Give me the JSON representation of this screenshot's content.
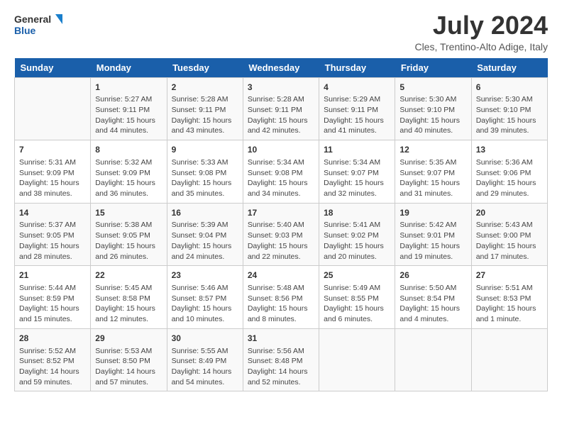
{
  "header": {
    "logo_line1": "General",
    "logo_line2": "Blue",
    "month_year": "July 2024",
    "location": "Cles, Trentino-Alto Adige, Italy"
  },
  "weekdays": [
    "Sunday",
    "Monday",
    "Tuesday",
    "Wednesday",
    "Thursday",
    "Friday",
    "Saturday"
  ],
  "weeks": [
    [
      {
        "day": "",
        "info": ""
      },
      {
        "day": "1",
        "info": "Sunrise: 5:27 AM\nSunset: 9:11 PM\nDaylight: 15 hours\nand 44 minutes."
      },
      {
        "day": "2",
        "info": "Sunrise: 5:28 AM\nSunset: 9:11 PM\nDaylight: 15 hours\nand 43 minutes."
      },
      {
        "day": "3",
        "info": "Sunrise: 5:28 AM\nSunset: 9:11 PM\nDaylight: 15 hours\nand 42 minutes."
      },
      {
        "day": "4",
        "info": "Sunrise: 5:29 AM\nSunset: 9:11 PM\nDaylight: 15 hours\nand 41 minutes."
      },
      {
        "day": "5",
        "info": "Sunrise: 5:30 AM\nSunset: 9:10 PM\nDaylight: 15 hours\nand 40 minutes."
      },
      {
        "day": "6",
        "info": "Sunrise: 5:30 AM\nSunset: 9:10 PM\nDaylight: 15 hours\nand 39 minutes."
      }
    ],
    [
      {
        "day": "7",
        "info": "Sunrise: 5:31 AM\nSunset: 9:09 PM\nDaylight: 15 hours\nand 38 minutes."
      },
      {
        "day": "8",
        "info": "Sunrise: 5:32 AM\nSunset: 9:09 PM\nDaylight: 15 hours\nand 36 minutes."
      },
      {
        "day": "9",
        "info": "Sunrise: 5:33 AM\nSunset: 9:08 PM\nDaylight: 15 hours\nand 35 minutes."
      },
      {
        "day": "10",
        "info": "Sunrise: 5:34 AM\nSunset: 9:08 PM\nDaylight: 15 hours\nand 34 minutes."
      },
      {
        "day": "11",
        "info": "Sunrise: 5:34 AM\nSunset: 9:07 PM\nDaylight: 15 hours\nand 32 minutes."
      },
      {
        "day": "12",
        "info": "Sunrise: 5:35 AM\nSunset: 9:07 PM\nDaylight: 15 hours\nand 31 minutes."
      },
      {
        "day": "13",
        "info": "Sunrise: 5:36 AM\nSunset: 9:06 PM\nDaylight: 15 hours\nand 29 minutes."
      }
    ],
    [
      {
        "day": "14",
        "info": "Sunrise: 5:37 AM\nSunset: 9:05 PM\nDaylight: 15 hours\nand 28 minutes."
      },
      {
        "day": "15",
        "info": "Sunrise: 5:38 AM\nSunset: 9:05 PM\nDaylight: 15 hours\nand 26 minutes."
      },
      {
        "day": "16",
        "info": "Sunrise: 5:39 AM\nSunset: 9:04 PM\nDaylight: 15 hours\nand 24 minutes."
      },
      {
        "day": "17",
        "info": "Sunrise: 5:40 AM\nSunset: 9:03 PM\nDaylight: 15 hours\nand 22 minutes."
      },
      {
        "day": "18",
        "info": "Sunrise: 5:41 AM\nSunset: 9:02 PM\nDaylight: 15 hours\nand 20 minutes."
      },
      {
        "day": "19",
        "info": "Sunrise: 5:42 AM\nSunset: 9:01 PM\nDaylight: 15 hours\nand 19 minutes."
      },
      {
        "day": "20",
        "info": "Sunrise: 5:43 AM\nSunset: 9:00 PM\nDaylight: 15 hours\nand 17 minutes."
      }
    ],
    [
      {
        "day": "21",
        "info": "Sunrise: 5:44 AM\nSunset: 8:59 PM\nDaylight: 15 hours\nand 15 minutes."
      },
      {
        "day": "22",
        "info": "Sunrise: 5:45 AM\nSunset: 8:58 PM\nDaylight: 15 hours\nand 12 minutes."
      },
      {
        "day": "23",
        "info": "Sunrise: 5:46 AM\nSunset: 8:57 PM\nDaylight: 15 hours\nand 10 minutes."
      },
      {
        "day": "24",
        "info": "Sunrise: 5:48 AM\nSunset: 8:56 PM\nDaylight: 15 hours\nand 8 minutes."
      },
      {
        "day": "25",
        "info": "Sunrise: 5:49 AM\nSunset: 8:55 PM\nDaylight: 15 hours\nand 6 minutes."
      },
      {
        "day": "26",
        "info": "Sunrise: 5:50 AM\nSunset: 8:54 PM\nDaylight: 15 hours\nand 4 minutes."
      },
      {
        "day": "27",
        "info": "Sunrise: 5:51 AM\nSunset: 8:53 PM\nDaylight: 15 hours\nand 1 minute."
      }
    ],
    [
      {
        "day": "28",
        "info": "Sunrise: 5:52 AM\nSunset: 8:52 PM\nDaylight: 14 hours\nand 59 minutes."
      },
      {
        "day": "29",
        "info": "Sunrise: 5:53 AM\nSunset: 8:50 PM\nDaylight: 14 hours\nand 57 minutes."
      },
      {
        "day": "30",
        "info": "Sunrise: 5:55 AM\nSunset: 8:49 PM\nDaylight: 14 hours\nand 54 minutes."
      },
      {
        "day": "31",
        "info": "Sunrise: 5:56 AM\nSunset: 8:48 PM\nDaylight: 14 hours\nand 52 minutes."
      },
      {
        "day": "",
        "info": ""
      },
      {
        "day": "",
        "info": ""
      },
      {
        "day": "",
        "info": ""
      }
    ]
  ]
}
